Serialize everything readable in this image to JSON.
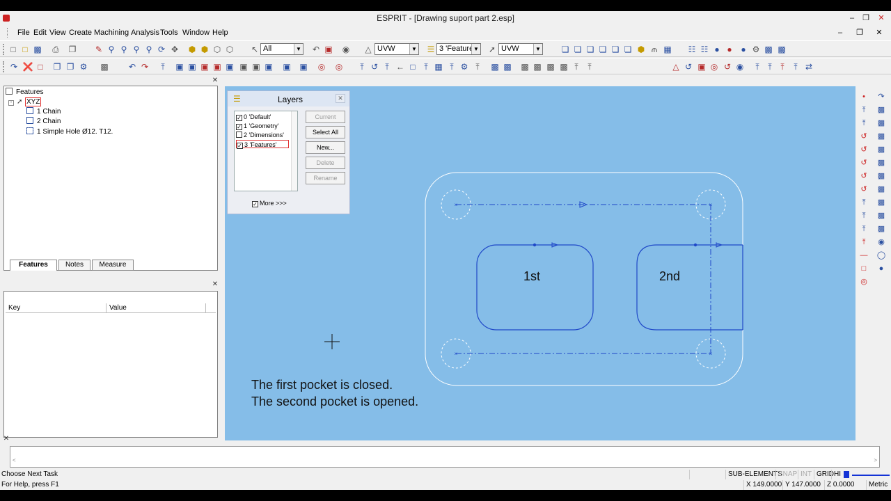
{
  "window": {
    "title": "ESPRIT - [Drawing suport part 2.esp]"
  },
  "menu": [
    "File",
    "Edit",
    "View",
    "Create",
    "Machining",
    "Analysis",
    "Tools",
    "Window",
    "Help"
  ],
  "toolbar": {
    "select_filter": "All",
    "work_plane_1": "UVW",
    "layer_combo": "3 'Features'",
    "work_plane_2": "UVW"
  },
  "features_panel": {
    "title": "Features",
    "root": "XYZ",
    "items": [
      "1 Chain",
      "2 Chain",
      "1 Simple Hole Ø12. T12."
    ]
  },
  "tabs": [
    "Features",
    "Notes",
    "Measure"
  ],
  "properties": {
    "columns": [
      "Key",
      "Value"
    ]
  },
  "layers": {
    "title": "Layers",
    "items": [
      {
        "label": "0 'Default'",
        "checked": true
      },
      {
        "label": "1 'Geometry'",
        "checked": true
      },
      {
        "label": "2 'Dimensions'",
        "checked": false
      },
      {
        "label": "3 'Features'",
        "checked": true
      }
    ],
    "buttons": [
      "Current",
      "Select All",
      "New...",
      "Delete",
      "Rename"
    ],
    "more_label": "More >>>"
  },
  "drawing": {
    "pocket1_label": "1st",
    "pocket2_label": "2nd",
    "caption_line1": "The first pocket is closed.",
    "caption_line2": "The second pocket is opened."
  },
  "status": {
    "task": "Choose Next Task",
    "help": "For Help, press F1",
    "sub_elements": "SUB-ELEMENTS",
    "snap": "SNAP",
    "int": "INT",
    "grid": "GRID",
    "hi": "HI",
    "x": "X 149.0000",
    "y": "Y 147.0000",
    "z": "Z 0.0000",
    "units": "Metric"
  },
  "colors": {
    "viewport": "#85bde8",
    "geometry": "#1f48c8",
    "selection": "#e03030"
  }
}
